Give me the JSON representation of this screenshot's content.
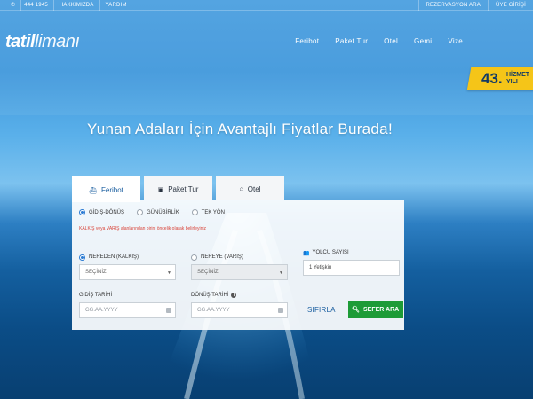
{
  "topbar": {
    "phone": "444 1945",
    "about": "HAKKIMIZDA",
    "help": "YARDIM",
    "reservation_search": "REZERVASYON ARA",
    "member_login": "ÜYE GİRİŞİ"
  },
  "logo": {
    "bold": "tatil",
    "light": "limanı"
  },
  "nav": [
    "Feribot",
    "Paket Tur",
    "Otel",
    "Gemi",
    "Vize"
  ],
  "badge": {
    "number": "43.",
    "line1": "HİZMET",
    "line2": "YILI"
  },
  "hero": {
    "title": "Yunan Adaları İçin Avantajlı Fiyatlar Burada!"
  },
  "tabs": [
    {
      "label": "Feribot",
      "icon": "ferry-icon"
    },
    {
      "label": "Paket Tur",
      "icon": "suitcase-icon"
    },
    {
      "label": "Otel",
      "icon": "home-icon"
    }
  ],
  "trip_type": {
    "options": [
      "GİDİŞ-DÖNÜŞ",
      "GÜNÜBİRLİK",
      "TEK YÖN"
    ],
    "selected": "GİDİŞ-DÖNÜŞ"
  },
  "warning": "KALKIŞ veya VARIŞ alanlarından birini öncelik olarak belirleyiniz",
  "origin": {
    "label": "NEREDEN (KALKIŞ)",
    "value": "SEÇİNİZ"
  },
  "destination": {
    "label": "NEREYE (VARIŞ)",
    "value": "SEÇİNİZ"
  },
  "passengers": {
    "label": "YOLCU SAYISI",
    "value": "1 Yetişkin"
  },
  "depart_date": {
    "label": "GİDİŞ TARİHİ",
    "placeholder": "GG.AA.YYYY"
  },
  "return_date": {
    "label": "DÖNÜŞ TARİHİ",
    "placeholder": "GG.AA.YYYY"
  },
  "actions": {
    "reset": "SIFIRLA",
    "search": "SEFER ARA"
  },
  "colors": {
    "accent": "#1b5fa0",
    "search_button": "#1d9b37",
    "badge": "#f5c518",
    "warning": "#d9443a"
  }
}
